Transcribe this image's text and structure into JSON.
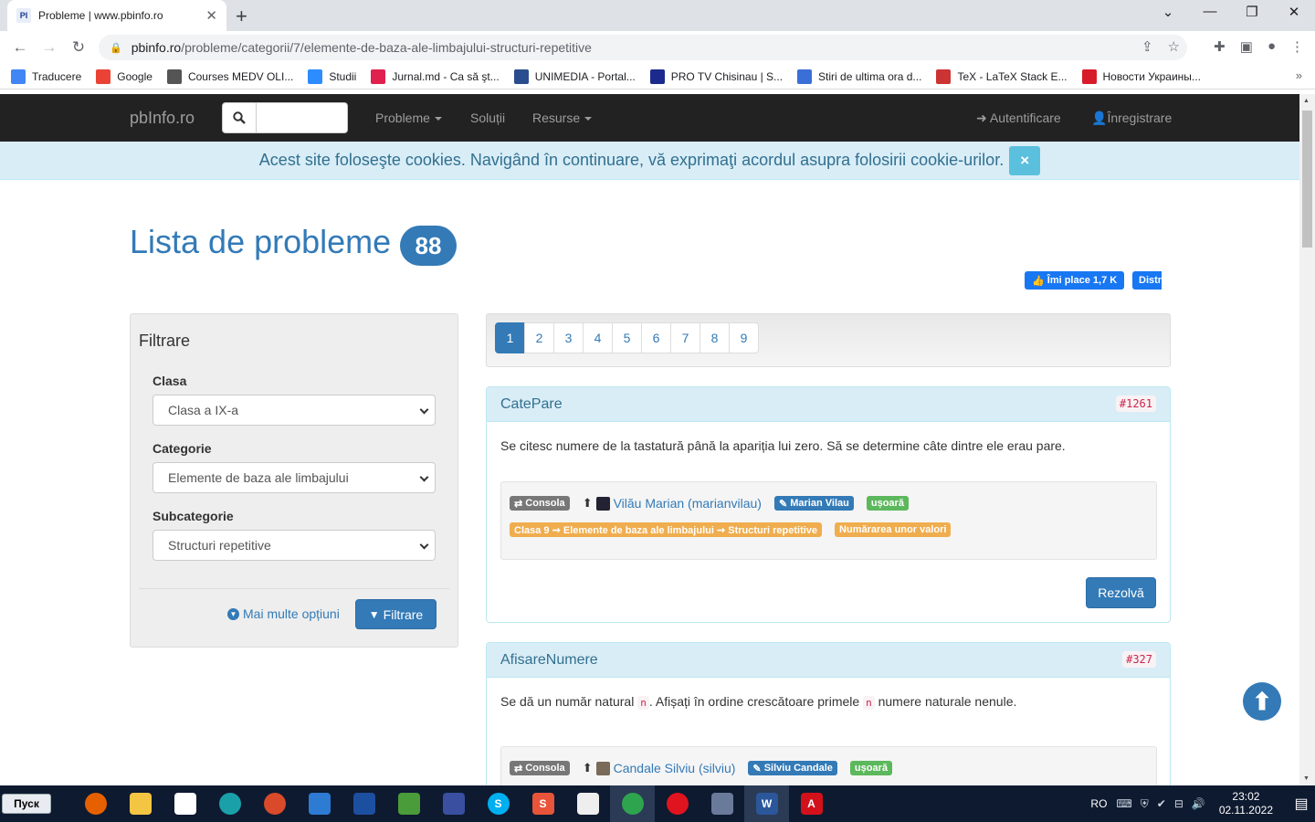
{
  "browser": {
    "tab_title": "Probleme | www.pbinfo.ro",
    "tab_favicon": "PI",
    "url_host": "pbinfo.ro",
    "url_path": "/probleme/categorii/7/elemente-de-baza-ale-limbajului-structuri-repetitive",
    "bookmarks": [
      {
        "label": "Traducere",
        "icon": "translate-icon",
        "color": "#4285f4"
      },
      {
        "label": "Google",
        "icon": "google-icon",
        "color": "#ea4335"
      },
      {
        "label": "Courses MEDV OLI...",
        "icon": "globe-icon",
        "color": "#555555"
      },
      {
        "label": "Studii",
        "icon": "st-icon",
        "color": "#2d8cff"
      },
      {
        "label": "Jurnal.md - Ca să şt...",
        "icon": "jurnal-icon",
        "color": "#e0204f"
      },
      {
        "label": "UNIMEDIA - Portal...",
        "icon": "unimedia-icon",
        "color": "#2a4d8f"
      },
      {
        "label": "PRO TV Chisinau | S...",
        "icon": "protv-icon",
        "color": "#1b2a8c"
      },
      {
        "label": "Stiri de ultima ora d...",
        "icon": "drop-icon",
        "color": "#3b6fd8"
      },
      {
        "label": "TeX - LaTeX Stack E...",
        "icon": "tex-icon",
        "color": "#cc3333"
      },
      {
        "label": "Новости Украины...",
        "icon": "news-icon",
        "color": "#d81b2a"
      }
    ]
  },
  "site": {
    "brand": "pbInfo.ro",
    "nav": {
      "probleme": "Probleme",
      "solutii": "Soluții",
      "resurse": "Resurse",
      "login": "Autentificare",
      "register": "Înregistrare"
    },
    "cookie_text": "Acest site foloseşte cookies. Navigând în continuare, vă exprimaţi acordul asupra folosirii cookie-urilor.",
    "cookie_close": "×",
    "page_title": "Lista de probleme",
    "problem_count": "88",
    "fb_like": "Îmi place 1,7 K",
    "fb_share": "Distr"
  },
  "filter": {
    "title": "Filtrare",
    "clasa_label": "Clasa",
    "clasa_value": "Clasa a IX-a",
    "categorie_label": "Categorie",
    "categorie_value": "Elemente de baza ale limbajului",
    "subcategorie_label": "Subcategorie",
    "subcategorie_value": "Structuri repetitive",
    "more_options": "Mai multe opțiuni",
    "submit": "Filtrare"
  },
  "pagination": [
    "1",
    "2",
    "3",
    "4",
    "5",
    "6",
    "7",
    "8",
    "9"
  ],
  "problems": [
    {
      "name": "CatePare",
      "id": "#1261",
      "description": "Se citesc numere de la tastatură până la apariția lui zero. Să se determine câte dintre ele erau pare.",
      "type": "Consola",
      "author": "Vilău Marian (marianvilau)",
      "editor": "Marian Vilau",
      "difficulty": "ușoară",
      "category": "Clasa 9 ➞ Elemente de baza ale limbajului ➞ Structuri repetitive",
      "tag": "Numărarea unor valori",
      "solve": "Rezolvă"
    },
    {
      "name": "AfisareNumere",
      "id": "#327",
      "desc_a": "Se dă un număr natural",
      "desc_var": "n",
      "desc_b": ". Afișați în ordine crescătoare primele",
      "desc_c": "numere naturale nenule.",
      "type": "Consola",
      "author": "Candale Silviu (silviu)",
      "editor": "Silviu Candale",
      "difficulty": "ușoară"
    }
  ],
  "taskbar": {
    "start": "Пуск",
    "lang": "RO",
    "time": "23:02",
    "date": "02.11.2022"
  }
}
